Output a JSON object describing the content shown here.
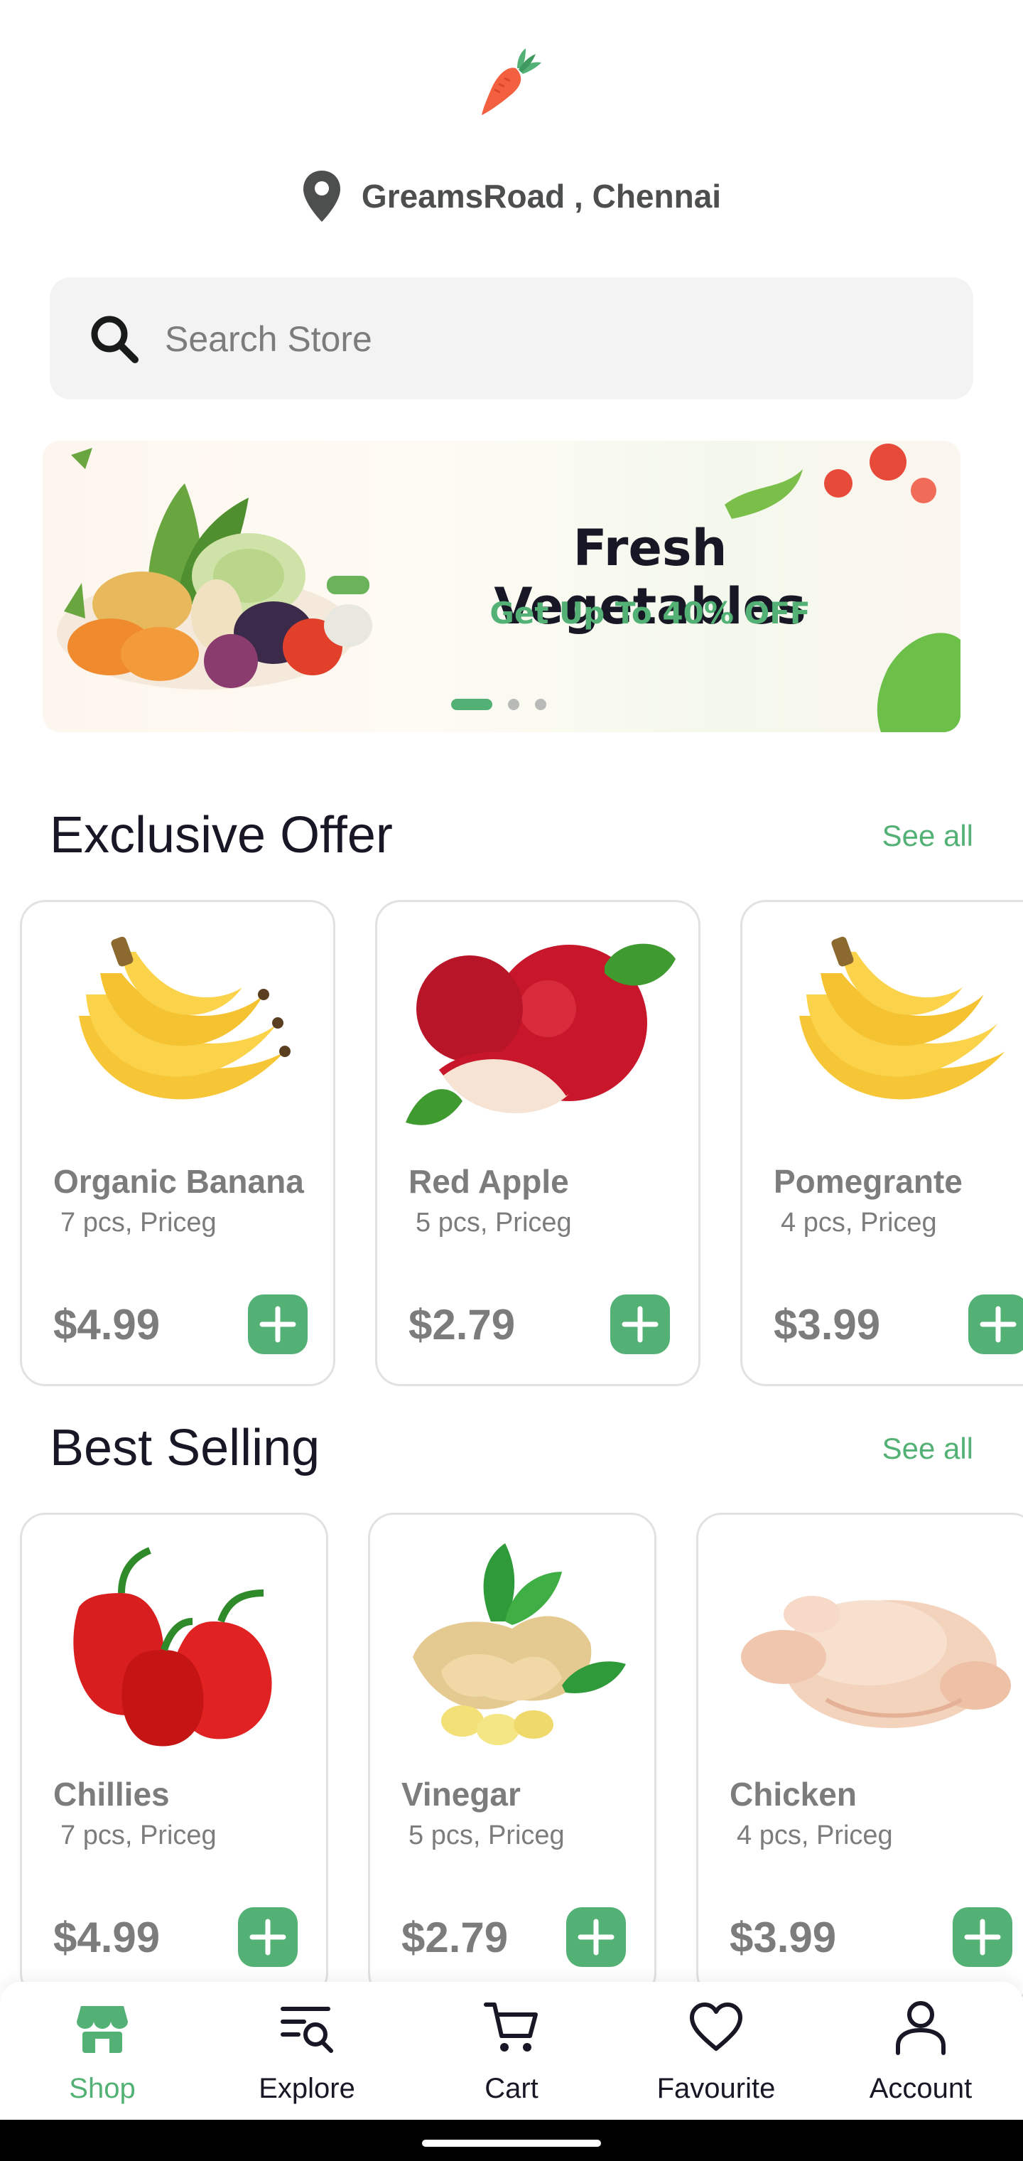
{
  "header": {
    "location": "GreamsRoad , Chennai"
  },
  "search": {
    "placeholder": "Search Store",
    "value": ""
  },
  "banner": {
    "title": "Fresh Vegetables",
    "subtitle": "Get Up To 40% OFF",
    "active_slide": 1,
    "slide_count": 3
  },
  "exclusive_offer": {
    "title": "Exclusive Offer",
    "see_all": "See all",
    "products": [
      {
        "name": "Organic Banana",
        "desc": "7 pcs, Priceg",
        "price": "$4.99",
        "image": "banana"
      },
      {
        "name": "Red Apple",
        "desc": "5 pcs, Priceg",
        "price": "$2.79",
        "image": "apple"
      },
      {
        "name": "Pomegrante",
        "desc": "4 pcs, Priceg",
        "price": "$3.99",
        "image": "banana"
      }
    ]
  },
  "best_selling": {
    "title": "Best Selling",
    "see_all": "See all",
    "products": [
      {
        "name": "Chillies",
        "desc": "7 pcs, Priceg",
        "price": "$4.99",
        "image": "bell-pepper"
      },
      {
        "name": "Vinegar",
        "desc": "5 pcs, Priceg",
        "price": "$2.79",
        "image": "ginger"
      },
      {
        "name": "Chicken",
        "desc": "4 pcs, Priceg",
        "price": "$3.99",
        "image": "chicken"
      }
    ]
  },
  "bottom_nav": {
    "active": "Shop",
    "items": [
      {
        "label": "Shop",
        "icon": "store-icon"
      },
      {
        "label": "Explore",
        "icon": "explore-icon"
      },
      {
        "label": "Cart",
        "icon": "cart-icon"
      },
      {
        "label": "Favourite",
        "icon": "heart-icon"
      },
      {
        "label": "Account",
        "icon": "user-icon"
      }
    ]
  },
  "colors": {
    "accent": "#53b175",
    "text_dark": "#181725",
    "text_muted": "#7c7c7c",
    "search_bg": "#f2f3f2"
  }
}
